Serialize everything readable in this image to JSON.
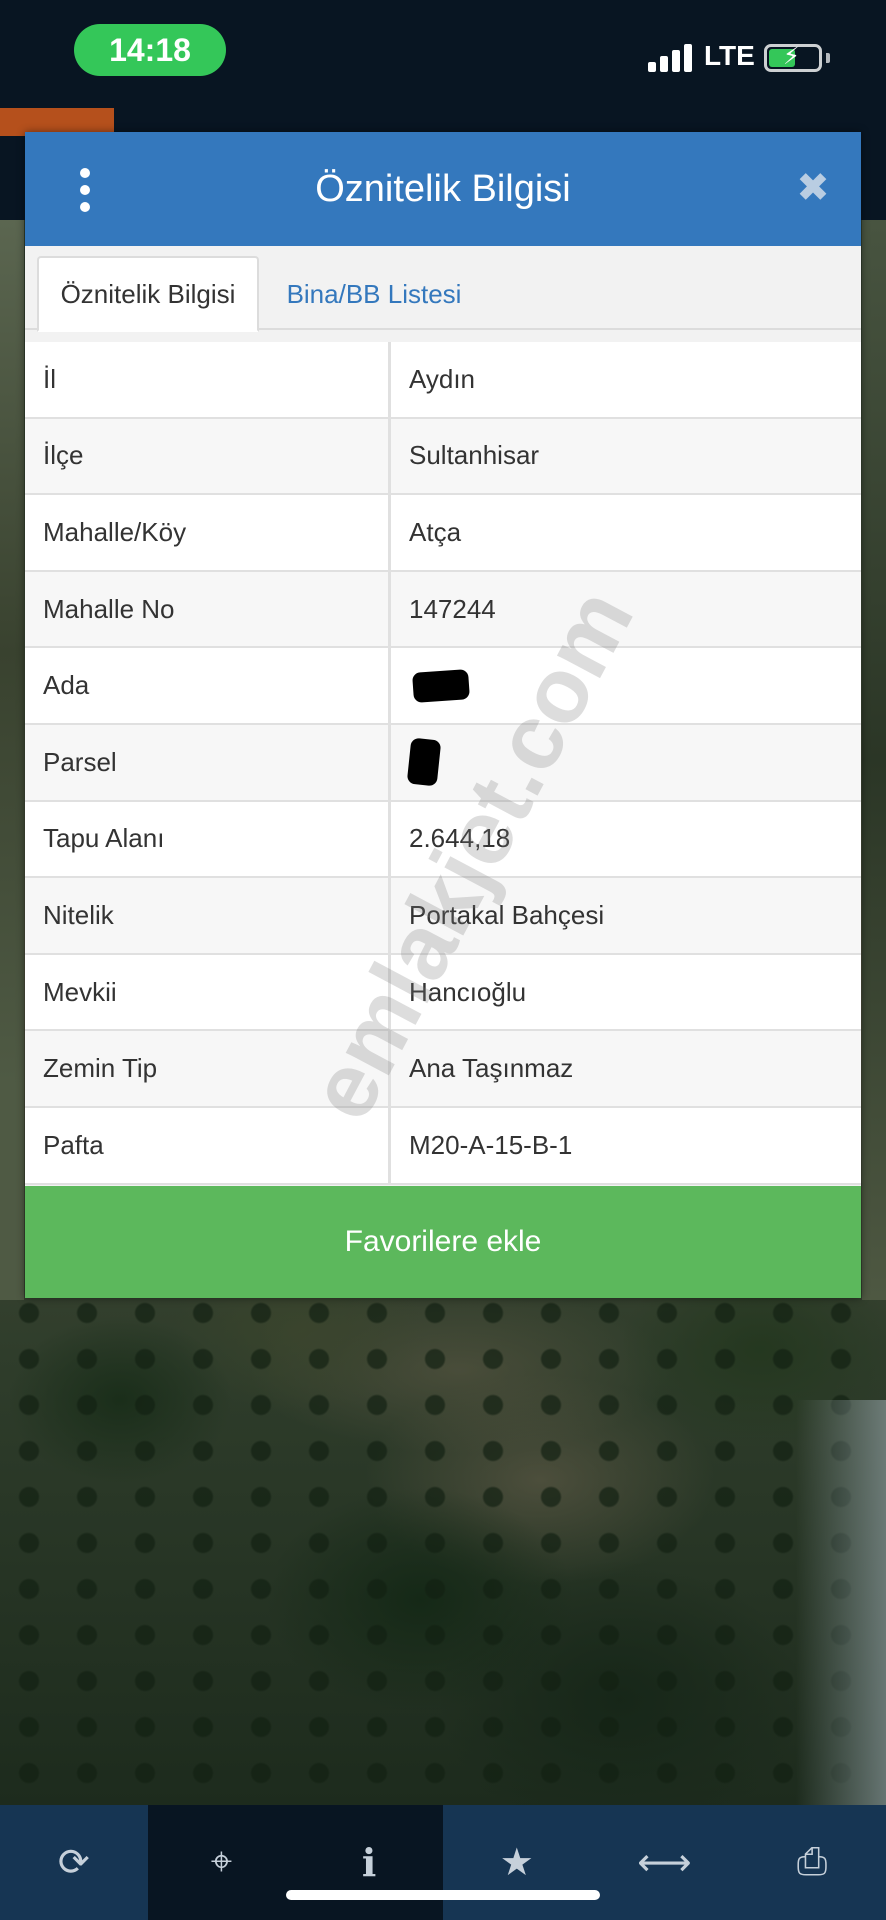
{
  "status_bar": {
    "time": "14:18",
    "network": "LTE",
    "battery_charging": true
  },
  "dialog": {
    "title": "Öznitelik Bilgisi",
    "tabs": [
      {
        "label": "Öznitelik Bilgisi",
        "active": true
      },
      {
        "label": "Bina/BB Listesi",
        "active": false
      }
    ],
    "rows": [
      {
        "key": "İl",
        "value": "Aydın"
      },
      {
        "key": "İlçe",
        "value": "Sultanhisar"
      },
      {
        "key": "Mahalle/Köy",
        "value": "Atça"
      },
      {
        "key": "Mahalle No",
        "value": "147244"
      },
      {
        "key": "Ada",
        "value": ""
      },
      {
        "key": "Parsel",
        "value": ""
      },
      {
        "key": "Tapu Alanı",
        "value": "2.644,18"
      },
      {
        "key": "Nitelik",
        "value": "Portakal Bahçesi"
      },
      {
        "key": "Mevkii",
        "value": "Hancıoğlu"
      },
      {
        "key": "Zemin Tip",
        "value": "Ana Taşınmaz"
      },
      {
        "key": "Pafta",
        "value": "M20-A-15-B-1"
      }
    ],
    "favorite_button": "Favorilere ekle"
  },
  "watermark": "emlakjet.com",
  "toolbar": {
    "items": [
      {
        "icon": "refresh-icon",
        "glyph": "⟳"
      },
      {
        "icon": "locate-icon",
        "glyph": "⌖"
      },
      {
        "icon": "info-icon",
        "glyph": "i"
      },
      {
        "icon": "star-icon",
        "glyph": "★"
      },
      {
        "icon": "measure-icon",
        "glyph": "⟷"
      },
      {
        "icon": "print-icon",
        "glyph": "⎙"
      }
    ]
  },
  "colors": {
    "header_blue": "#3478bd",
    "button_green": "#5cb85c",
    "status_pill_green": "#34c759",
    "toolbar_bg": "#163553"
  }
}
